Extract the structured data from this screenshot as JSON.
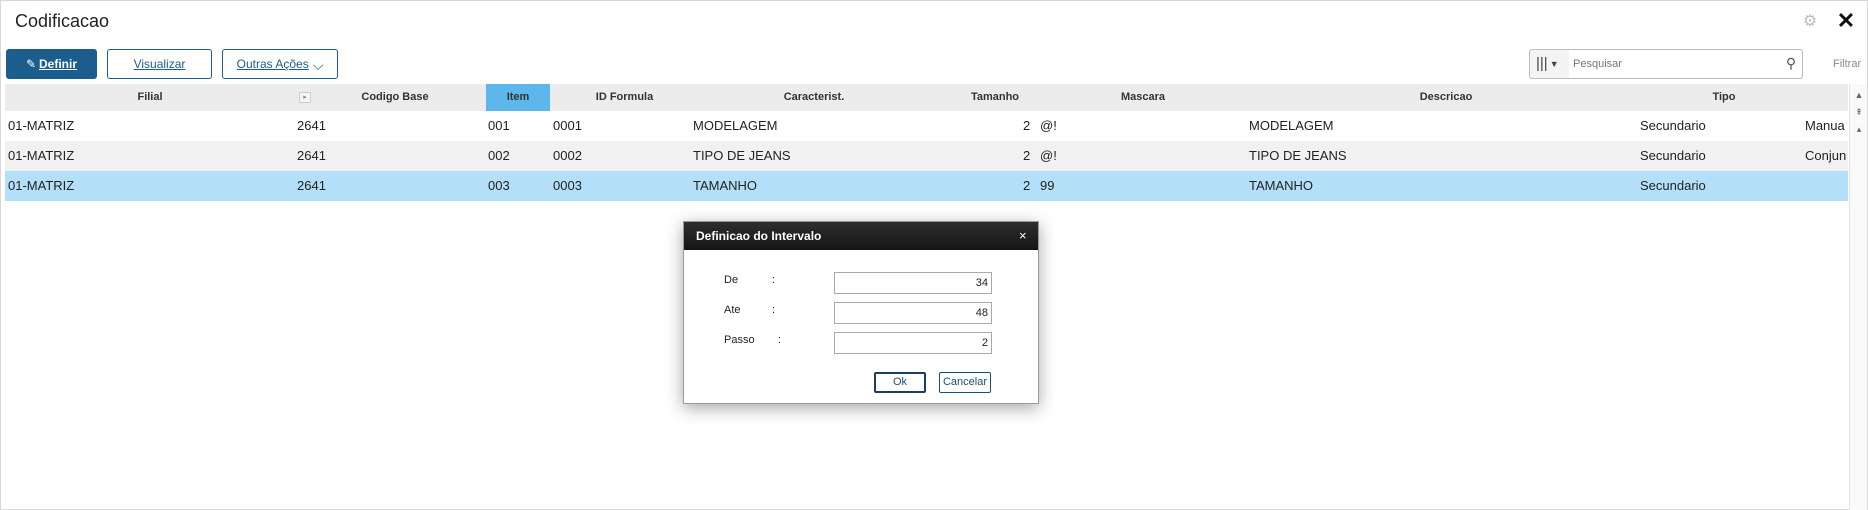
{
  "window": {
    "title": "Codificacao"
  },
  "toolbar": {
    "definir_label": "Definir",
    "visualizar_label": "Visualizar",
    "outras_label": "Outras Ações",
    "search_placeholder": "Pesquisar",
    "filter_label": "Filtrar"
  },
  "grid": {
    "headers": {
      "filial": "Filial",
      "codigo_base": "Codigo Base",
      "item": "Item",
      "id_formula": "ID Formula",
      "caracterist": "Caracterist.",
      "tamanho": "Tamanho",
      "mascara": "Mascara",
      "descricao": "Descricao",
      "tipo": "Tipo"
    },
    "rows": [
      {
        "filial": "01-MATRIZ",
        "codigo_base": "2641",
        "item": "001",
        "id_formula": "0001",
        "caracterist": "MODELAGEM",
        "tamanho": "2",
        "mascara": "@!",
        "descricao": "MODELAGEM",
        "tipo": "Secundario",
        "extra": "Manua"
      },
      {
        "filial": "01-MATRIZ",
        "codigo_base": "2641",
        "item": "002",
        "id_formula": "0002",
        "caracterist": "TIPO DE JEANS",
        "tamanho": "2",
        "mascara": "@!",
        "descricao": "TIPO DE JEANS",
        "tipo": "Secundario",
        "extra": "Conjun"
      },
      {
        "filial": "01-MATRIZ",
        "codigo_base": "2641",
        "item": "003",
        "id_formula": "0003",
        "caracterist": "TAMANHO",
        "tamanho": "2",
        "mascara": "99",
        "descricao": "TAMANHO",
        "tipo": "Secundario",
        "extra": ""
      }
    ],
    "selected_row": 2,
    "sorted_column": "Item"
  },
  "dialog": {
    "title": "Definicao do Intervalo",
    "fields": [
      {
        "label": "De",
        "colon": ":",
        "value": "34"
      },
      {
        "label": "Ate",
        "colon": ":",
        "value": "48"
      },
      {
        "label": "Passo",
        "colon": ":",
        "value": "2"
      }
    ],
    "ok_label": "Ok",
    "cancel_label": "Cancelar"
  },
  "colors": {
    "primary": "#1b5e8d",
    "selected_row": "#b4dff8",
    "sorted_header": "#5db7ea",
    "dialog_header": "#1e1e1e"
  },
  "icons": [
    "pencil-icon",
    "chevron-down-icon",
    "columns-icon",
    "search-icon",
    "gear-icon",
    "close-icon"
  ]
}
